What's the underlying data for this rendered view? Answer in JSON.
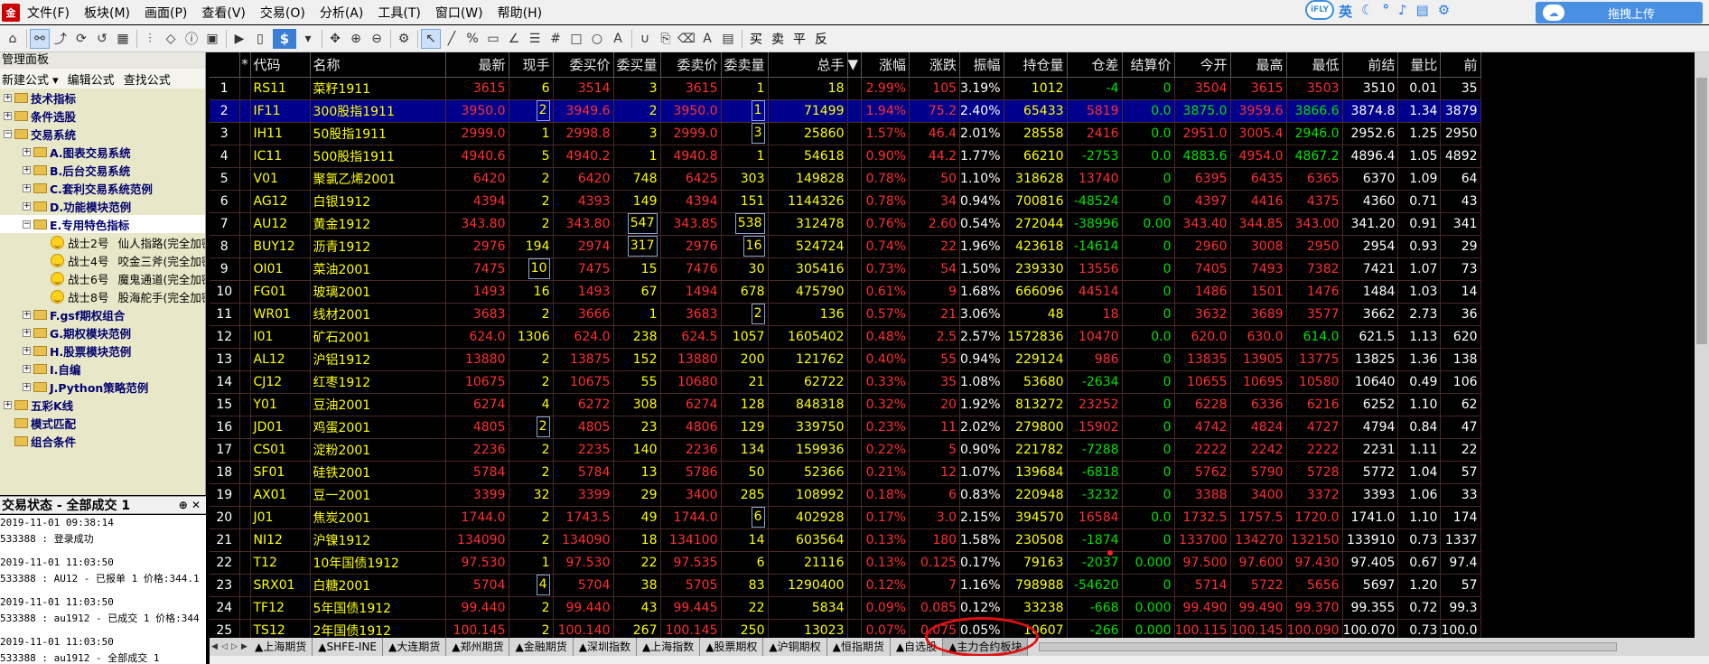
{
  "menubar": {
    "items": [
      "文件(F)",
      "板块(M)",
      "画面(P)",
      "查看(V)",
      "交易(O)",
      "分析(A)",
      "工具(T)",
      "窗口(W)",
      "帮助(H)"
    ],
    "ime_brand": "iFLY",
    "ime_lang": "英",
    "upload_label": "拖拽上传"
  },
  "toolbar": {
    "currency": "$",
    "zoom_in": "⊕",
    "zoom_out": "⊖",
    "text_tool": "A",
    "fib": "买",
    "fib2": "卖",
    "fib3": "平",
    "fib4": "反"
  },
  "left_panel": {
    "title": "管理面板",
    "links": [
      "新建公式 ▾",
      "编辑公式",
      "查找公式"
    ],
    "tree": [
      {
        "lvl": 0,
        "pm": "+",
        "label": "技术指标",
        "type": "folder"
      },
      {
        "lvl": 0,
        "pm": "+",
        "label": "条件选股",
        "type": "folder"
      },
      {
        "lvl": 0,
        "pm": "−",
        "label": "交易系统",
        "type": "folder"
      },
      {
        "lvl": 1,
        "pm": "+",
        "label": "A.图表交易系统",
        "type": "folder"
      },
      {
        "lvl": 1,
        "pm": "+",
        "label": "B.后台交易系统",
        "type": "folder"
      },
      {
        "lvl": 1,
        "pm": "+",
        "label": "C.套利交易系统范例",
        "type": "folder"
      },
      {
        "lvl": 1,
        "pm": "+",
        "label": "D.功能模块范例",
        "type": "folder"
      },
      {
        "lvl": 1,
        "pm": "−",
        "label": "E.专用特色指标",
        "type": "folder",
        "sel": true
      },
      {
        "lvl": 2,
        "label": "战士2号",
        "desc": "仙人指路(完全加密",
        "type": "smile"
      },
      {
        "lvl": 2,
        "label": "战士4号",
        "desc": "咬金三斧(完全加密",
        "type": "smile"
      },
      {
        "lvl": 2,
        "label": "战士6号",
        "desc": "魔鬼通道(完全加密",
        "type": "smile"
      },
      {
        "lvl": 2,
        "label": "战士8号",
        "desc": "股海舵手(完全加密",
        "type": "smile"
      },
      {
        "lvl": 1,
        "pm": "+",
        "label": "F.gsf期权组合",
        "type": "folder"
      },
      {
        "lvl": 1,
        "pm": "+",
        "label": "G.期权模块范例",
        "type": "folder"
      },
      {
        "lvl": 1,
        "pm": "+",
        "label": "H.股票模块范例",
        "type": "folder"
      },
      {
        "lvl": 1,
        "pm": "+",
        "label": "I.自编",
        "type": "folder"
      },
      {
        "lvl": 1,
        "pm": "+",
        "label": "J.Python策略范例",
        "type": "folder"
      },
      {
        "lvl": 0,
        "pm": "+",
        "label": "五彩K线",
        "type": "folder"
      },
      {
        "lvl": 0,
        "pm": "",
        "label": "模式匹配",
        "type": "folder"
      },
      {
        "lvl": 0,
        "pm": "",
        "label": "组合条件",
        "type": "folder"
      }
    ]
  },
  "trade_status": {
    "title": "交易状态 - 全部成交 1",
    "pin": "⊕",
    "close": "✕",
    "log": [
      [
        "2019-11-01 09:38:14",
        "533388 : 登录成功"
      ],
      [
        "2019-11-01 11:03:50",
        "533388 : AU12 - 已报单 1 价格:344.1"
      ],
      [
        "2019-11-01 11:03:50",
        "533388 : au1912 - 已成交 1 价格:344"
      ],
      [
        "2019-11-01 11:03:50",
        "533388 : au1912 - 全部成交 1"
      ]
    ]
  },
  "grid": {
    "headers": [
      "",
      "*",
      "代码",
      "名称",
      "最新",
      "现手",
      "委买价",
      "委买量",
      "委卖价",
      "委卖量",
      "总手",
      "▼",
      "涨幅",
      "涨跌",
      "振幅",
      "持仓量",
      "仓差",
      "结算价",
      "今开",
      "最高",
      "最低",
      "前结",
      "量比",
      "前"
    ],
    "rows": [
      [
        "1",
        "RS11",
        "菜籽1911",
        "3615",
        "6",
        "3514",
        "3",
        "3615",
        "1",
        "18",
        "2.99%",
        "105",
        "3.19%",
        "1012",
        "-4",
        "0",
        "3504",
        "3615",
        "3503",
        "3510",
        "0.01",
        "35"
      ],
      [
        "2",
        "IF11",
        "300股指1911",
        "3950.0",
        "2",
        "3949.6",
        "2",
        "3950.0",
        "1",
        "71499",
        "1.94%",
        "75.2",
        "2.40%",
        "65433",
        "5819",
        "0.0",
        "3875.0",
        "3959.6",
        "3866.6",
        "3874.8",
        "1.34",
        "3879"
      ],
      [
        "3",
        "IH11",
        "50股指1911",
        "2999.0",
        "1",
        "2998.8",
        "3",
        "2999.0",
        "3",
        "25860",
        "1.57%",
        "46.4",
        "2.01%",
        "28558",
        "2416",
        "0.0",
        "2951.0",
        "3005.4",
        "2946.0",
        "2952.6",
        "1.25",
        "2950"
      ],
      [
        "4",
        "IC11",
        "500股指1911",
        "4940.6",
        "5",
        "4940.2",
        "1",
        "4940.8",
        "1",
        "54618",
        "0.90%",
        "44.2",
        "1.77%",
        "66210",
        "-2753",
        "0.0",
        "4883.6",
        "4954.0",
        "4867.2",
        "4896.4",
        "1.05",
        "4892"
      ],
      [
        "5",
        "V01",
        "聚氯乙烯2001",
        "6420",
        "2",
        "6420",
        "748",
        "6425",
        "303",
        "149828",
        "0.78%",
        "50",
        "1.10%",
        "318628",
        "13740",
        "0",
        "6395",
        "6435",
        "6365",
        "6370",
        "1.09",
        "64"
      ],
      [
        "6",
        "AG12",
        "白银1912",
        "4394",
        "2",
        "4393",
        "149",
        "4394",
        "151",
        "1144326",
        "0.78%",
        "34",
        "0.94%",
        "700816",
        "-48524",
        "0",
        "4397",
        "4416",
        "4375",
        "4360",
        "0.71",
        "43"
      ],
      [
        "7",
        "AU12",
        "黄金1912",
        "343.80",
        "2",
        "343.80",
        "547",
        "343.85",
        "538",
        "312478",
        "0.76%",
        "2.60",
        "0.54%",
        "272044",
        "-38996",
        "0.00",
        "343.40",
        "344.85",
        "343.00",
        "341.20",
        "0.91",
        "341"
      ],
      [
        "8",
        "BUY12",
        "沥青1912",
        "2976",
        "194",
        "2974",
        "317",
        "2976",
        "16",
        "524724",
        "0.74%",
        "22",
        "1.96%",
        "423618",
        "-14614",
        "0",
        "2960",
        "3008",
        "2950",
        "2954",
        "0.93",
        "29"
      ],
      [
        "9",
        "OI01",
        "菜油2001",
        "7475",
        "10",
        "7475",
        "15",
        "7476",
        "30",
        "305416",
        "0.73%",
        "54",
        "1.50%",
        "239330",
        "13556",
        "0",
        "7405",
        "7493",
        "7382",
        "7421",
        "1.07",
        "73"
      ],
      [
        "10",
        "FG01",
        "玻璃2001",
        "1493",
        "16",
        "1493",
        "67",
        "1494",
        "678",
        "475790",
        "0.61%",
        "9",
        "1.68%",
        "666096",
        "44514",
        "0",
        "1486",
        "1501",
        "1476",
        "1484",
        "1.03",
        "14"
      ],
      [
        "11",
        "WR01",
        "线材2001",
        "3683",
        "2",
        "3666",
        "1",
        "3683",
        "2",
        "136",
        "0.57%",
        "21",
        "3.06%",
        "48",
        "18",
        "0",
        "3632",
        "3689",
        "3577",
        "3662",
        "2.73",
        "36"
      ],
      [
        "12",
        "I01",
        "矿石2001",
        "624.0",
        "1306",
        "624.0",
        "238",
        "624.5",
        "1057",
        "1605402",
        "0.48%",
        "2.5",
        "2.57%",
        "1572836",
        "10470",
        "0.0",
        "620.0",
        "630.0",
        "614.0",
        "621.5",
        "1.13",
        "620"
      ],
      [
        "13",
        "AL12",
        "沪铝1912",
        "13880",
        "2",
        "13875",
        "152",
        "13880",
        "200",
        "121762",
        "0.40%",
        "55",
        "0.94%",
        "229124",
        "986",
        "0",
        "13835",
        "13905",
        "13775",
        "13825",
        "1.36",
        "138"
      ],
      [
        "14",
        "CJ12",
        "红枣1912",
        "10675",
        "2",
        "10675",
        "55",
        "10680",
        "21",
        "62722",
        "0.33%",
        "35",
        "1.08%",
        "53680",
        "-2634",
        "0",
        "10655",
        "10695",
        "10580",
        "10640",
        "0.49",
        "106"
      ],
      [
        "15",
        "Y01",
        "豆油2001",
        "6274",
        "4",
        "6272",
        "308",
        "6274",
        "128",
        "848318",
        "0.32%",
        "20",
        "1.92%",
        "813272",
        "23252",
        "0",
        "6228",
        "6336",
        "6216",
        "6252",
        "1.10",
        "62"
      ],
      [
        "16",
        "JD01",
        "鸡蛋2001",
        "4805",
        "2",
        "4805",
        "23",
        "4806",
        "129",
        "339750",
        "0.23%",
        "11",
        "2.02%",
        "279800",
        "15902",
        "0",
        "4742",
        "4824",
        "4727",
        "4794",
        "0.84",
        "47"
      ],
      [
        "17",
        "CS01",
        "淀粉2001",
        "2236",
        "2",
        "2235",
        "140",
        "2236",
        "134",
        "159936",
        "0.22%",
        "5",
        "0.90%",
        "221782",
        "-7288",
        "0",
        "2222",
        "2242",
        "2222",
        "2231",
        "1.11",
        "22"
      ],
      [
        "18",
        "SF01",
        "硅铁2001",
        "5784",
        "2",
        "5784",
        "13",
        "5786",
        "50",
        "52366",
        "0.21%",
        "12",
        "1.07%",
        "139684",
        "-6818",
        "0",
        "5762",
        "5790",
        "5728",
        "5772",
        "1.04",
        "57"
      ],
      [
        "19",
        "AX01",
        "豆一2001",
        "3399",
        "32",
        "3399",
        "29",
        "3400",
        "285",
        "108992",
        "0.18%",
        "6",
        "0.83%",
        "220948",
        "-3232",
        "0",
        "3388",
        "3400",
        "3372",
        "3393",
        "1.06",
        "33"
      ],
      [
        "20",
        "J01",
        "焦炭2001",
        "1744.0",
        "2",
        "1743.5",
        "49",
        "1744.0",
        "6",
        "402928",
        "0.17%",
        "3.0",
        "2.15%",
        "394570",
        "16584",
        "0.0",
        "1732.5",
        "1757.5",
        "1720.0",
        "1741.0",
        "1.10",
        "174"
      ],
      [
        "21",
        "NI12",
        "沪镍1912",
        "134090",
        "2",
        "134090",
        "18",
        "134100",
        "14",
        "603564",
        "0.13%",
        "180",
        "1.58%",
        "230508",
        "-1874",
        "0",
        "133700",
        "134270",
        "132150",
        "133910",
        "0.73",
        "1337"
      ],
      [
        "22",
        "T12",
        "10年国债1912",
        "97.530",
        "1",
        "97.530",
        "22",
        "97.535",
        "6",
        "21116",
        "0.13%",
        "0.125",
        "0.17%",
        "79163",
        "-2037",
        "0.000",
        "97.500",
        "97.600",
        "97.430",
        "97.405",
        "0.67",
        "97.4"
      ],
      [
        "23",
        "SRX01",
        "白糖2001",
        "5704",
        "4",
        "5704",
        "38",
        "5705",
        "83",
        "1290400",
        "0.12%",
        "7",
        "1.16%",
        "798988",
        "-54620",
        "0",
        "5714",
        "5722",
        "5656",
        "5697",
        "1.20",
        "57"
      ],
      [
        "24",
        "TF12",
        "5年国债1912",
        "99.440",
        "2",
        "99.440",
        "43",
        "99.445",
        "22",
        "5834",
        "0.09%",
        "0.085",
        "0.12%",
        "33238",
        "-668",
        "0.000",
        "99.490",
        "99.490",
        "99.370",
        "99.355",
        "0.72",
        "99.3"
      ],
      [
        "25",
        "TS12",
        "2年国债1912",
        "100.145",
        "2",
        "100.140",
        "267",
        "100.145",
        "250",
        "13023",
        "0.07%",
        "0.075",
        "0.05%",
        "10607",
        "-266",
        "0.000",
        "100.115",
        "100.145",
        "100.090",
        "100.070",
        "0.73",
        "100.0"
      ]
    ]
  },
  "tabs": [
    "▲上海期货",
    "▲SHFE-INE",
    "▲大连期货",
    "▲郑州期货",
    "▲金融期货",
    "▲深圳指数",
    "▲上海指数",
    "▲股票期权",
    "▲沪铜期权",
    "▲恒指期货",
    "▲自选股",
    "▲主力合约板块"
  ],
  "active_tab": "▲主力合约板块"
}
